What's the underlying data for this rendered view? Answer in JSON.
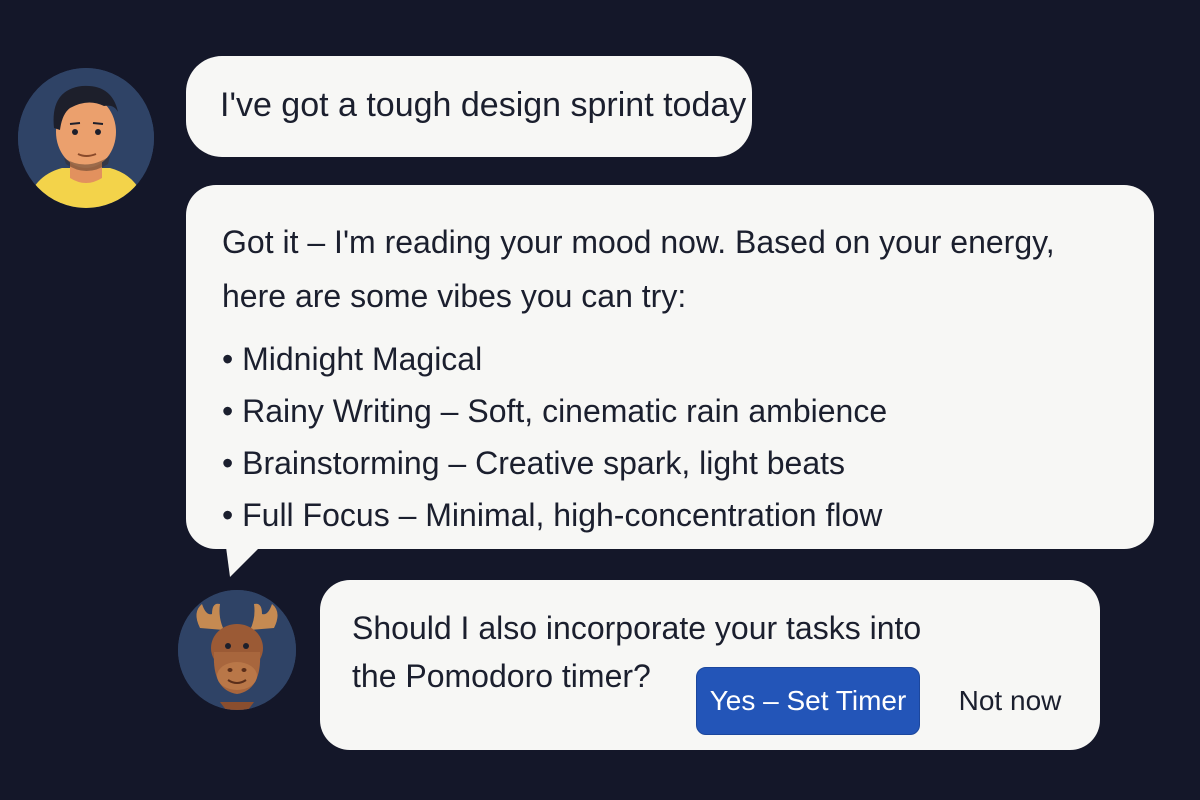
{
  "colors": {
    "background": "#141729",
    "bubble": "#f7f7f5",
    "avatar_bg": "#2f4366",
    "primary_button": "#2355b8"
  },
  "messages": {
    "user": {
      "avatar_icon": "person-avatar-icon",
      "text": "I've got a tough design sprint today"
    },
    "assistant": {
      "avatar_icon": "moose-avatar-icon",
      "intro": "Got it – I'm reading your mood now. Based on your energy, here are some vibes you can try:",
      "vibes": [
        "Midnight Magical",
        "Rainy Writing – Soft, cinematic rain ambience",
        "Brainstorming – Creative spark, light beats",
        "Full Focus – Minimal, high-concentration flow"
      ],
      "question": "Should I also incorporate your tasks into the Pomodoro timer?",
      "actions": {
        "confirm_label": "Yes – Set Timer",
        "dismiss_label": "Not now"
      }
    }
  }
}
